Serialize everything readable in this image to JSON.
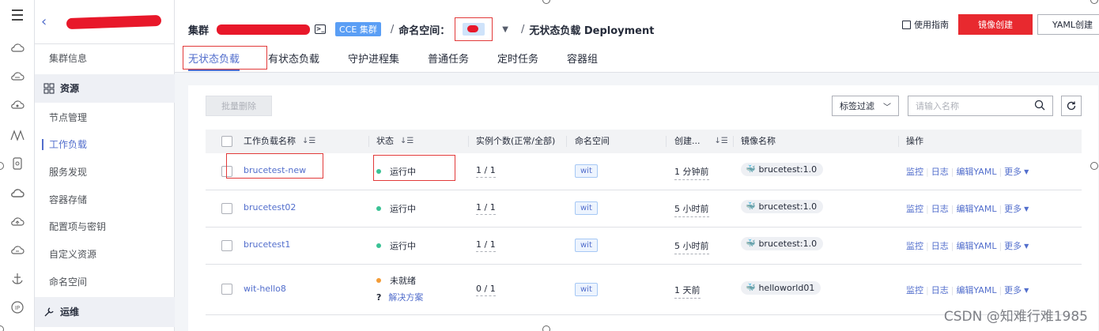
{
  "rail": {
    "icons": [
      "menu-icon",
      "cloud-icon",
      "cloud-disk-icon",
      "database-icon",
      "mountain-icon",
      "container-icon",
      "cloud-outline-icon",
      "cloud-upload-icon",
      "cloud-sync-icon",
      "anchor-icon",
      "ip-icon"
    ]
  },
  "sidebar": {
    "items": [
      {
        "label": "集群信息",
        "kind": "item"
      },
      {
        "label": "资源",
        "kind": "group"
      },
      {
        "label": "节点管理",
        "kind": "item"
      },
      {
        "label": "工作负载",
        "kind": "item",
        "active": true
      },
      {
        "label": "服务发现",
        "kind": "item"
      },
      {
        "label": "容器存储",
        "kind": "item"
      },
      {
        "label": "配置项与密钥",
        "kind": "item"
      },
      {
        "label": "自定义资源",
        "kind": "item"
      },
      {
        "label": "命名空间",
        "kind": "item"
      },
      {
        "label": "运维",
        "kind": "group"
      }
    ]
  },
  "header": {
    "cluster_label": "集群",
    "cce_badge": "CCE 集群",
    "namespace_label": "命名空间：",
    "sep": "/",
    "page_title": "无状态负载 Deployment",
    "guide_label": "使用指南",
    "image_create_label": "镜像创建",
    "yaml_create_label": "YAML创建"
  },
  "tabs": [
    {
      "label": "无状态负载",
      "active": true
    },
    {
      "label": "有状态负载"
    },
    {
      "label": "守护进程集"
    },
    {
      "label": "普通任务"
    },
    {
      "label": "定时任务"
    },
    {
      "label": "容器组"
    }
  ],
  "toolbar": {
    "bulk_delete_label": "批量删除",
    "label_filter_label": "标签过滤",
    "search_placeholder": "请输入名称"
  },
  "table": {
    "columns": [
      "工作负载名称",
      "状态",
      "实例个数(正常/全部)",
      "命名空间",
      "创建...",
      "镜像名称",
      "操作"
    ],
    "rows": [
      {
        "name": "brucetest-new",
        "status": "运行中",
        "status_color": "#3ac295",
        "instances": "1 / 1",
        "namespace": "wit",
        "created": "1 分钟前",
        "image": "brucetest:1.0"
      },
      {
        "name": "brucetest02",
        "status": "运行中",
        "status_color": "#3ac295",
        "instances": "1 / 1",
        "namespace": "wit",
        "created": "5 小时前",
        "image": "brucetest:1.0"
      },
      {
        "name": "brucetest1",
        "status": "运行中",
        "status_color": "#3ac295",
        "instances": "1 / 1",
        "namespace": "wit",
        "created": "5 小时前",
        "image": "brucetest:1.0"
      },
      {
        "name": "wit-hello8",
        "status": "未就绪",
        "status_color": "#f39c37",
        "status_help": "解决方案",
        "instances": "0 / 1",
        "namespace": "wit",
        "created": "1 天前",
        "image": "helloworld01"
      }
    ],
    "actions": {
      "monitor": "监控",
      "log": "日志",
      "edit_yaml": "编辑YAML",
      "more": "更多"
    }
  },
  "watermark": "CSDN @知难行难1985"
}
